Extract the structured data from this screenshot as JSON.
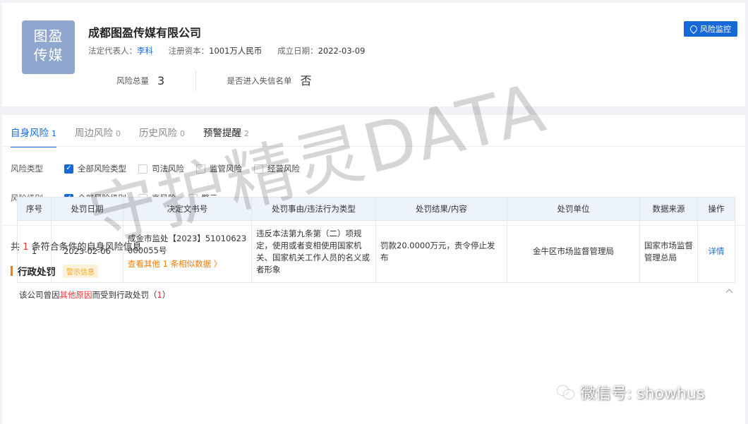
{
  "company": {
    "logo_lines": [
      "图盈",
      "传媒"
    ],
    "name": "成都图盈传媒有限公司",
    "legal_rep_label": "法定代表人：",
    "legal_rep": "李科",
    "capital_label": "注册资本：",
    "capital": "1001万人民币",
    "founded_label": "成立日期：",
    "founded": "2022-03-09",
    "risk_total_label": "风险总量",
    "risk_total": "3",
    "blacklist_label": "是否进入失信名单",
    "blacklist": "否",
    "monitor_button": "风险监控"
  },
  "tabs": [
    {
      "label": "自身风险",
      "count": "1"
    },
    {
      "label": "周边风险",
      "count": "0"
    },
    {
      "label": "历史风险",
      "count": "0"
    },
    {
      "label": "预警提醒",
      "count": "2"
    }
  ],
  "filters": {
    "type_label": "风险类型",
    "type_options": [
      {
        "label": "全部风险类型",
        "checked": true
      },
      {
        "label": "司法风险",
        "checked": false
      },
      {
        "label": "监管风险",
        "checked": false
      },
      {
        "label": "经营风险",
        "checked": false
      }
    ],
    "level_label": "风险级别",
    "level_options": [
      {
        "label": "全部风险级别",
        "checked": true
      },
      {
        "label": "高风险",
        "checked": false
      },
      {
        "label": "警示",
        "checked": false
      }
    ]
  },
  "result": {
    "prefix": "共",
    "count": "1",
    "suffix": "条符合条件的自身风险信息"
  },
  "section": {
    "title": "行政处罚",
    "badge": "警示信息",
    "sub_prefix": "该公司曾因",
    "sub_reason": "其他原因",
    "sub_middle": "而受到行政处罚（",
    "sub_count": "1",
    "sub_suffix": "）"
  },
  "table": {
    "headers": [
      "序号",
      "处罚日期",
      "决定文书号",
      "处罚事由/违法行为类型",
      "处罚结果/内容",
      "处罚单位",
      "数据来源",
      "操作"
    ],
    "rows": [
      {
        "index": "1",
        "date": "2023-02-06",
        "doc_no": "成金市监处【2023】51010623000055号",
        "more": "查看其他 1 条相似数据 〉",
        "reason": "违反本法第九条第（二）项规定，使用或者变相使用国家机关、国家机关工作人员的名义或者形象",
        "result": "罚款20.0000万元，责令停止发布",
        "unit": "金牛区市场监督管理局",
        "source": "国家市场监督管理总局",
        "action": "详情"
      }
    ]
  },
  "watermark": "守护精灵DATA",
  "wechat_mark": "微信号: showhus"
}
